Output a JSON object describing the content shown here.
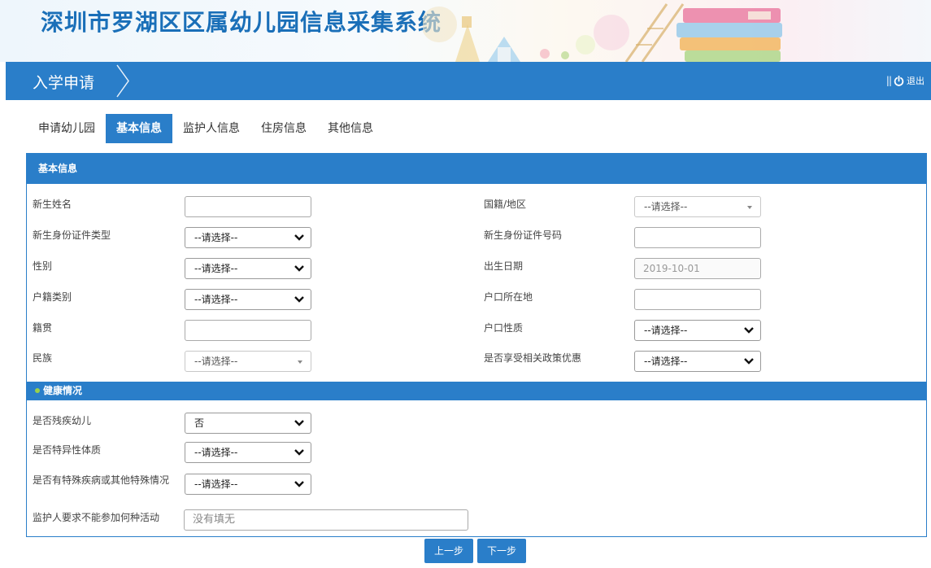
{
  "app": {
    "title": "深圳市罗湖区区属幼儿园信息采集系统"
  },
  "nav": {
    "page_title": "入学申请",
    "logout_label": "退出",
    "logout_bars": "||"
  },
  "tabs": [
    {
      "label": "申请幼儿园",
      "active": false
    },
    {
      "label": "基本信息",
      "active": true
    },
    {
      "label": "监护人信息",
      "active": false
    },
    {
      "label": "住房信息",
      "active": false
    },
    {
      "label": "其他信息",
      "active": false
    }
  ],
  "basic": {
    "heading": "基本信息",
    "left": {
      "name_label": "新生姓名",
      "name_value": "",
      "idtype_label": "新生身份证件类型",
      "idtype_value": "--请选择--",
      "gender_label": "性别",
      "gender_value": "--请选择--",
      "hukou_type_label": "户籍类别",
      "hukou_type_value": "--请选择--",
      "native_label": "籍贯",
      "native_value": "",
      "ethnic_label": "民族",
      "ethnic_value": "--请选择--"
    },
    "right": {
      "nationality_label": "国籍/地区",
      "nationality_value": "--请选择--",
      "idno_label": "新生身份证件号码",
      "idno_value": "",
      "birth_label": "出生日期",
      "birth_placeholder": "2019-10-01",
      "hukou_place_label": "户口所在地",
      "hukou_place_value": "",
      "hukou_nature_label": "户口性质",
      "hukou_nature_value": "--请选择--",
      "policy_label": "是否享受相关政策优惠",
      "policy_value": "--请选择--"
    }
  },
  "health": {
    "heading": "健康情况",
    "disabled_label": "是否残疾幼儿",
    "disabled_value": "否",
    "allergy_label": "是否特异性体质",
    "allergy_value": "--请选择--",
    "special_label": "是否有特殊疾病或其他特殊情况",
    "special_value": "--请选择--",
    "activity_label": "监护人要求不能参加何种活动",
    "activity_placeholder": "没有填无"
  },
  "buttons": {
    "prev": "上一步",
    "next": "下一步"
  },
  "colors": {
    "primary": "#2a7ec9",
    "title": "#1a6fb8"
  }
}
